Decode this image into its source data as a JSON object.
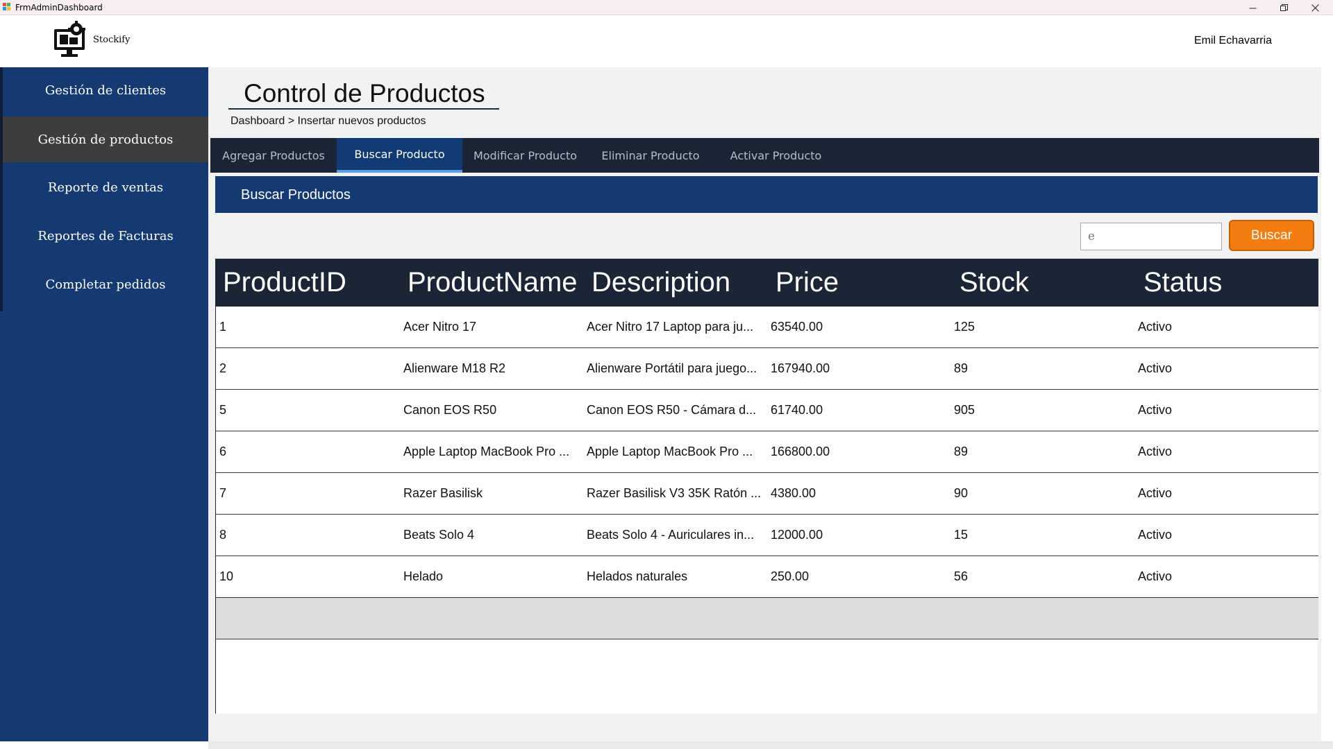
{
  "window": {
    "title": "FrmAdminDashboard",
    "controls": [
      "minimize",
      "restore",
      "close"
    ]
  },
  "header": {
    "brand": "Stockify",
    "user_name": "Emil Echavarria",
    "logo_icon": "computer-gear-icon"
  },
  "sidebar": {
    "items": [
      {
        "label": "Gestión de clientes",
        "active": false
      },
      {
        "label": "Gestión de productos",
        "active": true
      },
      {
        "label": "Reporte de ventas",
        "active": false
      },
      {
        "label": "Reportes de Facturas",
        "active": false
      },
      {
        "label": "Completar pedidos",
        "active": false
      }
    ]
  },
  "main": {
    "title": "Control de Productos",
    "breadcrumb": "Dashboard > Insertar nuevos productos",
    "tabs": [
      {
        "label": "Agregar Productos",
        "active": false
      },
      {
        "label": "Buscar Producto",
        "active": true
      },
      {
        "label": "Modificar Producto",
        "active": false
      },
      {
        "label": "Eliminar Producto",
        "active": false
      },
      {
        "label": "Activar Producto",
        "active": false
      }
    ],
    "section_title": "Buscar Productos",
    "search": {
      "value": "e",
      "button_label": "Buscar"
    },
    "table": {
      "columns": [
        "ProductID",
        "ProductName",
        "Description",
        "Price",
        "Stock",
        "Status"
      ],
      "rows": [
        [
          "1",
          "Acer Nitro 17",
          "Acer Nitro 17 Laptop para ju...",
          "63540.00",
          "125",
          "Activo"
        ],
        [
          "2",
          "Alienware M18 R2",
          "Alienware Portátil para juego...",
          "167940.00",
          "89",
          "Activo"
        ],
        [
          "5",
          "Canon EOS R50",
          "Canon EOS R50 - Cámara d...",
          "61740.00",
          "905",
          "Activo"
        ],
        [
          "6",
          "Apple Laptop MacBook Pro ...",
          "Apple Laptop MacBook Pro ...",
          "166800.00",
          "89",
          "Activo"
        ],
        [
          "7",
          "Razer Basilisk",
          "Razer Basilisk V3 35K Ratón ...",
          "4380.00",
          "90",
          "Activo"
        ],
        [
          "8",
          "Beats Solo 4",
          "Beats Solo 4 - Auriculares in...",
          "12000.00",
          "15",
          "Activo"
        ],
        [
          "10",
          "Helado",
          "Helados naturales",
          "250.00",
          "56",
          "Activo"
        ]
      ]
    }
  },
  "colors": {
    "sidebar": "#153a72",
    "sidebar_active": "#3d3d3d",
    "tabbar": "#1c2536",
    "tab_active": "#0f3a73",
    "section_band": "#143a73",
    "accent_button": "#f57c0e",
    "grid_header": "#1c2536"
  }
}
